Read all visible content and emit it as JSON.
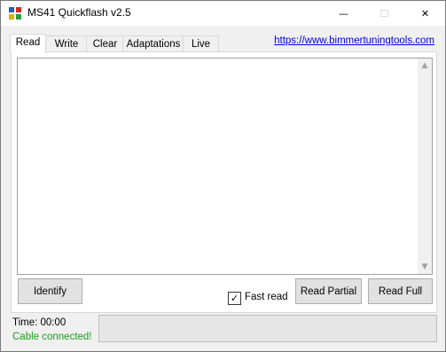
{
  "window": {
    "title": "MS41 Quickflash v2.5",
    "accent_color": "#06b025"
  },
  "caption_buttons": {
    "minimize": "—",
    "maximize": "☐",
    "close": "✕"
  },
  "tabs": [
    {
      "label": "Read",
      "active": true
    },
    {
      "label": "Write",
      "active": false
    },
    {
      "label": "Clear",
      "active": false
    },
    {
      "label": "Adaptations",
      "active": false
    },
    {
      "label": "Live",
      "active": false
    }
  ],
  "link": {
    "text": "https://www.bimmertuningtools.com"
  },
  "log": {
    "text": ""
  },
  "buttons": {
    "identify": "Identify",
    "read_partial": "Read Partial",
    "read_full": "Read Full"
  },
  "fast_read": {
    "label": "Fast read",
    "checked": true,
    "check_glyph": "✓"
  },
  "status": {
    "time": "Time: 00:00",
    "cable": "Cable connected!",
    "cable_color": "#1b9d1b"
  },
  "progress": {
    "value": 0
  }
}
